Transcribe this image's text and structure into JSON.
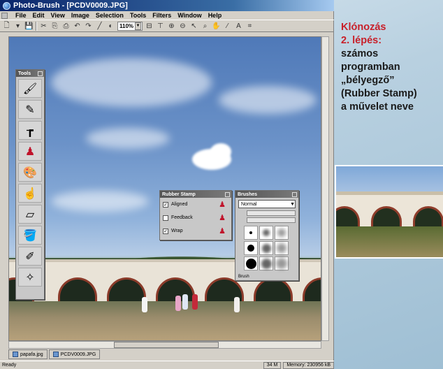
{
  "window": {
    "title": "Photo-Brush - [PCDV0009.JPG]"
  },
  "menu": [
    "File",
    "Edit",
    "View",
    "Image",
    "Selection",
    "Tools",
    "Filters",
    "Window",
    "Help"
  ],
  "toolbar": {
    "zoom": "110%"
  },
  "palettes": {
    "tools": {
      "title": "Tools"
    },
    "rubber_stamp": {
      "title": "Rubber Stamp",
      "options": [
        {
          "label": "Aligned",
          "checked": true
        },
        {
          "label": "Feedback",
          "checked": false
        },
        {
          "label": "Wrap",
          "checked": true
        }
      ]
    },
    "brushes": {
      "title": "Brushes",
      "mode": "Normal",
      "footer": "Brush"
    }
  },
  "doc_tabs": [
    "papafa.jpg",
    "PCDV0009.JPG"
  ],
  "status": {
    "left": "Ready",
    "mem": "34 M",
    "memory": "Memory: 230956 kB"
  },
  "caption": {
    "line1": "Klónozás",
    "line2": "2. lépés:",
    "line3": "számos",
    "line4": "programban",
    "line5": "„bélyegző”",
    "line6": "(Rubber Stamp)",
    "line7": "a művelet neve"
  },
  "colors": {
    "accent": "#c8202a",
    "title_bar": "#0a246a"
  }
}
